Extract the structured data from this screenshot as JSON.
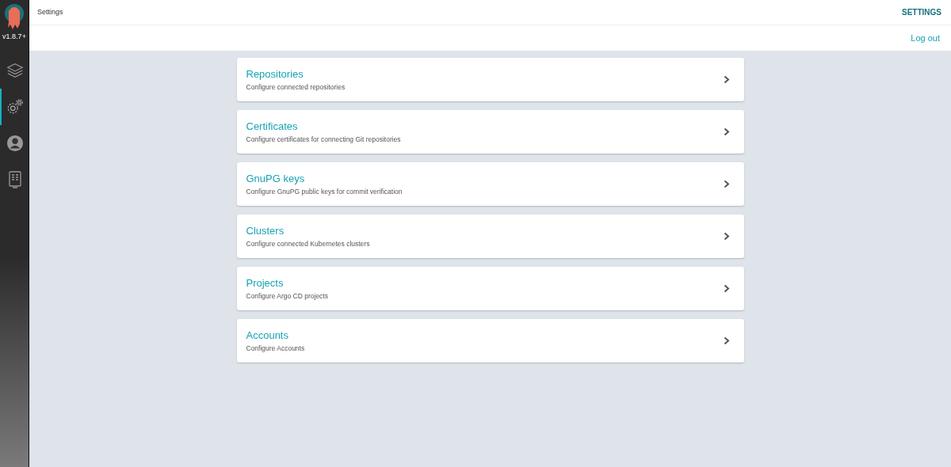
{
  "sidebar": {
    "version": "v1.8.7+",
    "items": [
      {
        "kind": "layers",
        "selected": false
      },
      {
        "kind": "gear",
        "selected": true
      },
      {
        "kind": "user",
        "selected": false
      },
      {
        "kind": "docs",
        "selected": false
      }
    ]
  },
  "top_bar": {
    "title": "Settings",
    "page_label": "SETTINGS",
    "logout": "Log out"
  },
  "settings_items": [
    {
      "title": "Repositories",
      "description": "Configure connected repositories"
    },
    {
      "title": "Certificates",
      "description": "Configure certificates for connecting Git repositories"
    },
    {
      "title": "GnuPG keys",
      "description": "Configure GnuPG public keys for commit verification"
    },
    {
      "title": "Clusters",
      "description": "Configure connected Kubernetes clusters"
    },
    {
      "title": "Projects",
      "description": "Configure Argo CD projects"
    },
    {
      "title": "Accounts",
      "description": "Configure Accounts"
    }
  ]
}
